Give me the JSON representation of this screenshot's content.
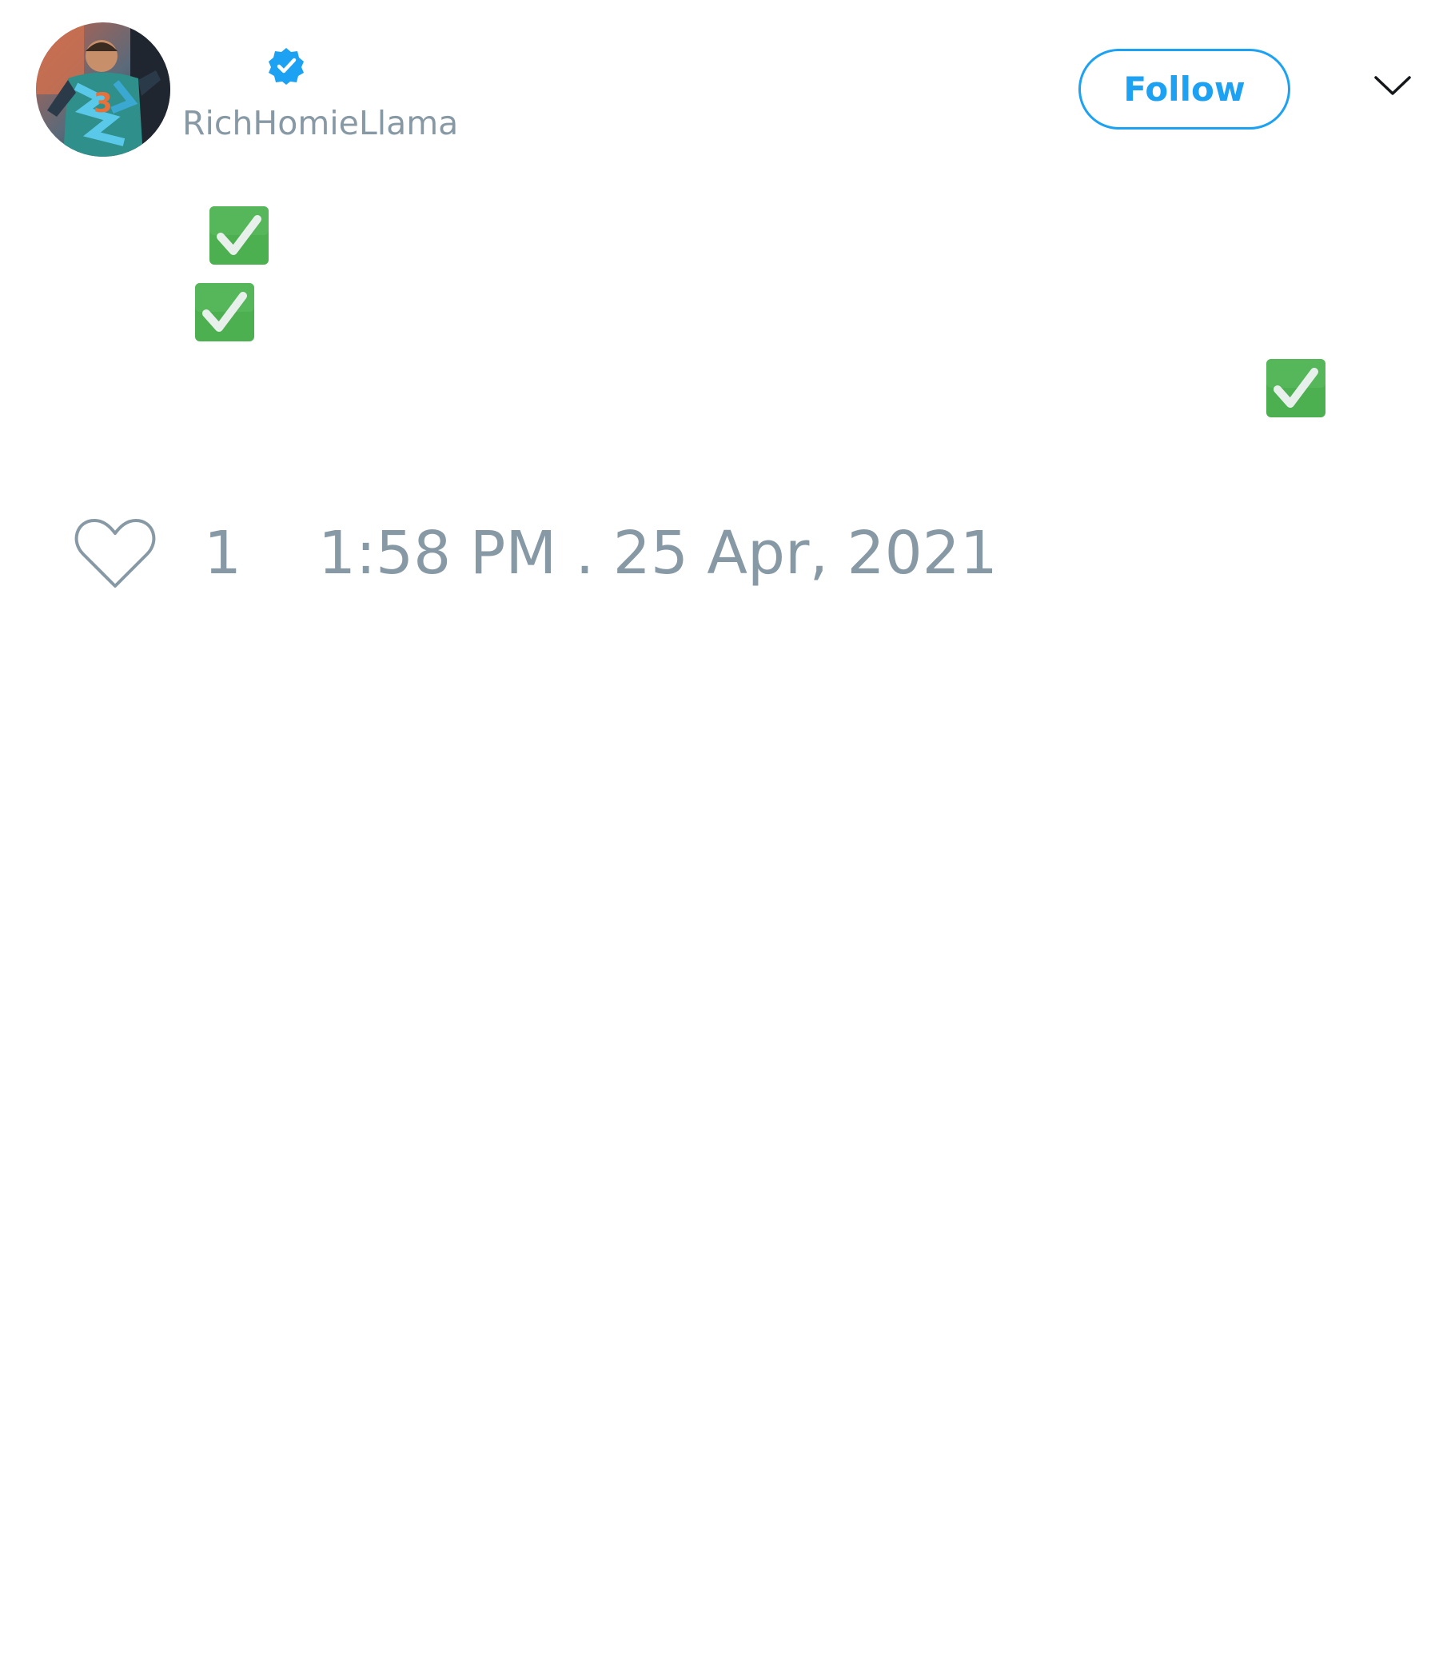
{
  "user": {
    "handle": "RichHomieLlama",
    "verified": true,
    "avatar_description": "avatar photo"
  },
  "header": {
    "follow_label": "Follow",
    "menu_icon": "chevron-down-icon"
  },
  "tweet": {
    "body_emojis": [
      "✅",
      "✅",
      "✅"
    ]
  },
  "footer": {
    "like_icon": "heart-icon",
    "like_count": "1",
    "timestamp": "1:58 PM . 25 Apr, 2021"
  },
  "colors": {
    "accent": "#1da1f2",
    "muted_text": "#8899a6",
    "check_green": "#4caf50",
    "background": "#ffffff"
  }
}
